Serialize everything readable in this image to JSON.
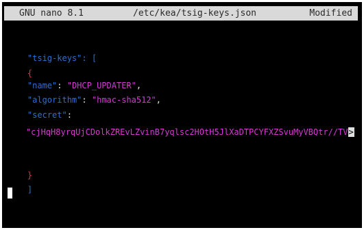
{
  "colors": {
    "key": "#2f6fcf",
    "string": "#d33ad0",
    "brace": "#e0314a",
    "punct": "#e6e6e6",
    "titlebar_bg": "#d9d9d9",
    "terminal_bg": "#000000"
  },
  "titlebar": {
    "version": "GNU nano 8.1",
    "filename": "/etc/kea/tsig-keys.json",
    "status": "Modified"
  },
  "editor": {
    "line1_key": "\"tsig-keys\"",
    "line1_rest": ": [",
    "line2": "{",
    "line3_key": "\"name\"",
    "line3_sep": ": ",
    "line3_value": "\"DHCP_UPDATER\"",
    "line3_end": ",",
    "line4_key": "\"algorithm\"",
    "line4_sep": ": ",
    "line4_value": "\"hmac-sha512\"",
    "line4_end": ",",
    "line5_key": "\"secret\"",
    "line5_sep": ":",
    "line6_value": "\"cjHqH8yrqUjCDolkZREvLZvinB7yqlsc2HOtH5JlXaDTPCYFXZSvuMyVBQtr//TV",
    "line6_overflow": ">",
    "line_close_brace": "}",
    "line_close_bracket": "]"
  }
}
